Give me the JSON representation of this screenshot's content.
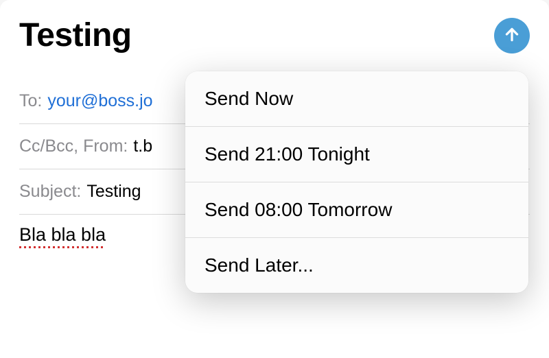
{
  "header": {
    "title": "Testing",
    "sendIcon": "arrow-up"
  },
  "fields": {
    "to": {
      "label": "To:",
      "value": "your@boss.jo"
    },
    "ccbccfrom": {
      "label": "Cc/Bcc, From:",
      "value": "t.b"
    },
    "subject": {
      "label": "Subject:",
      "value": "Testing"
    }
  },
  "body": "Bla bla bla",
  "sendMenu": {
    "items": [
      "Send Now",
      "Send 21:00 Tonight",
      "Send 08:00 Tomorrow",
      "Send Later..."
    ]
  },
  "colors": {
    "accent": "#4a9ed6",
    "link": "#1f6fd6",
    "secondaryLabel": "#8a8a8e",
    "spellError": "#d23030"
  }
}
